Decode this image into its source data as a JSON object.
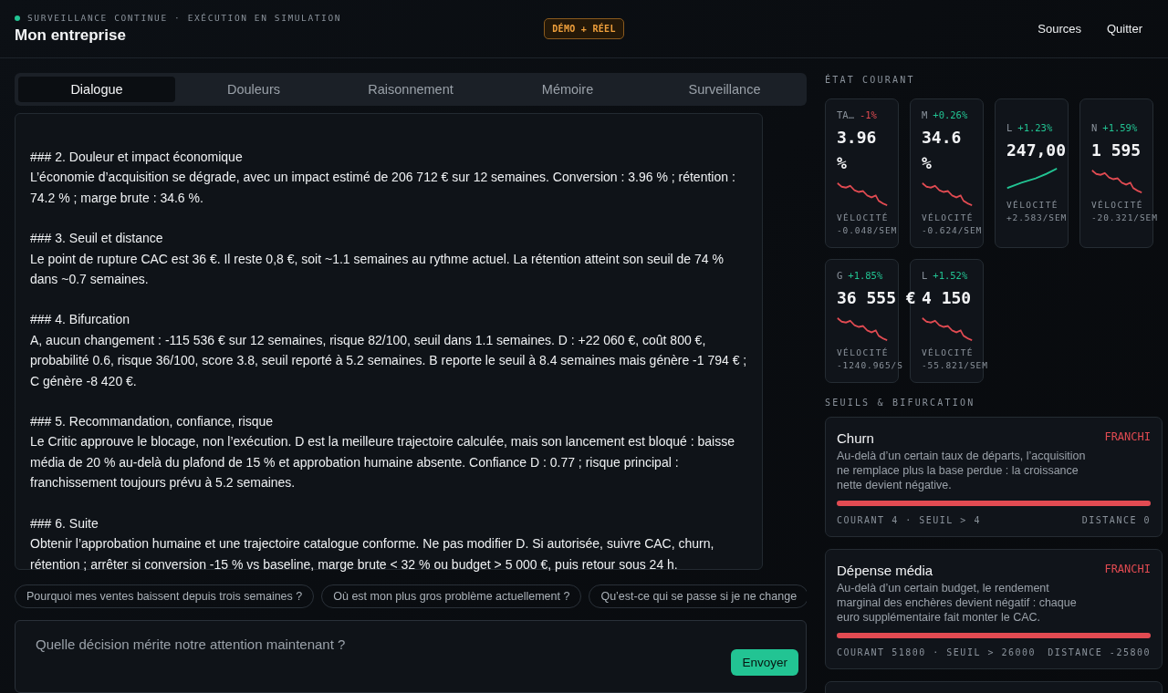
{
  "header": {
    "status": "SURVEILLANCE CONTINUE · EXÉCUTION EN SIMULATION",
    "live": true,
    "title": "Mon entreprise",
    "mode_badge": "DÉMO + RÉEL",
    "actions": [
      "Sources",
      "Quitter"
    ]
  },
  "tabs": [
    {
      "label": "Dialogue",
      "selected": true
    },
    {
      "label": "Douleurs",
      "selected": false
    },
    {
      "label": "Raisonnement",
      "selected": false
    },
    {
      "label": "Mémoire",
      "selected": false
    },
    {
      "label": "Surveillance",
      "selected": false
    }
  ],
  "message": {
    "sections": [
      {
        "heading": "### 2. Douleur et impact économique",
        "body": "L’économie d’acquisition se dégrade, avec un impact estimé de 206 712 € sur 12 semaines. Conversion : 3.96 % ; rétention : 74.2 % ; marge brute : 34.6 %."
      },
      {
        "heading": "### 3. Seuil et distance",
        "body": "Le point de rupture CAC est 36 €. Il reste 0,8 €, soit ~1.1 semaines au rythme actuel. La rétention atteint son seuil de 74 % dans ~0.7 semaines."
      },
      {
        "heading": "### 4. Bifurcation",
        "body": "A, aucun changement : -115 536 € sur 12 semaines, risque 82/100, seuil dans 1.1 semaines. D : +22 060 €, coût 800 €, probabilité 0.6, risque 36/100, score 3.8, seuil reporté à 5.2 semaines. B reporte le seuil à 8.4 semaines mais génère -1 794 € ; C génère -8 420 €."
      },
      {
        "heading": "### 5. Recommandation, confiance, risque",
        "body": "Le Critic approuve le blocage, non l’exécution. D est la meilleure trajectoire calculée, mais son lancement est bloqué : baisse média de 20 % au-delà du plafond de 15 % et approbation humaine absente. Confiance D : 0.77 ; risque principal : franchissement toujours prévu à 5.2 semaines."
      },
      {
        "heading": "### 6. Suite",
        "body": "Obtenir l’approbation humaine et une trajectoire catalogue conforme. Ne pas modifier D. Si autorisée, suivre CAC, churn, rétention ; arrêter si conversion -15 % vs baseline, marge brute < 32 % ou budget > 5 000 €, puis retour sous 24 h."
      }
    ]
  },
  "suggestions": [
    "Pourquoi mes ventes baissent depuis trois semaines ?",
    "Où est mon plus gros problème actuellement ?",
    "Qu’est-ce qui se passe si je ne change"
  ],
  "composer": {
    "placeholder": "Quelle décision mérite notre attention maintenant ?",
    "send": "Envoyer"
  },
  "state": {
    "title": "ÉTAT COURANT",
    "metrics": [
      {
        "label": "TA…",
        "change": "-1%",
        "rising": false,
        "value": "3.96 %",
        "velocity_label": "VÉLOCITÉ",
        "velocity": "-0.048/SEM"
      },
      {
        "label": "M",
        "change": "+0.26%",
        "rising": false,
        "value": "34.6 %",
        "velocity_label": "VÉLOCITÉ",
        "velocity": "-0.624/SEM"
      },
      {
        "label": "L",
        "change": "+1.23%",
        "rising": true,
        "value": "247,00",
        "velocity_label": "VÉLOCITÉ",
        "velocity": "+2.583/SEM"
      },
      {
        "label": "N",
        "change": "+1.59%",
        "rising": false,
        "value": "1 595",
        "velocity_label": "VÉLOCITÉ",
        "velocity": "-20.321/SEM"
      },
      {
        "label": "G",
        "change": "+1.85%",
        "rising": false,
        "value": "36 555 €",
        "velocity_label": "VÉLOCITÉ",
        "velocity": "-1240.965/S"
      },
      {
        "label": "L",
        "change": "+1.52%",
        "rising": false,
        "value": "4 150",
        "velocity_label": "VÉLOCITÉ",
        "velocity": "-55.821/SEM"
      }
    ]
  },
  "thresholds": {
    "title": "SEUILS & BIFURCATION",
    "items": [
      {
        "name": "Churn",
        "status": "FRANCHI",
        "crossed": true,
        "description": "Au-delà d’un certain taux de départs, l’acquisition ne remplace plus la base perdue : la croissance nette devient négative.",
        "level": 1,
        "reading": "COURANT 4 · SEUIL > 4",
        "distance": "DISTANCE 0"
      },
      {
        "name": "Dépense média",
        "status": "FRANCHI",
        "crossed": true,
        "description": "Au-delà d’un certain budget, le rendement marginal des enchères devient négatif : chaque euro supplémentaire fait monter le CAC.",
        "level": 1,
        "reading": "COURANT 51800 · SEUIL > 26000",
        "distance": "DISTANCE -25800"
      }
    ]
  }
}
